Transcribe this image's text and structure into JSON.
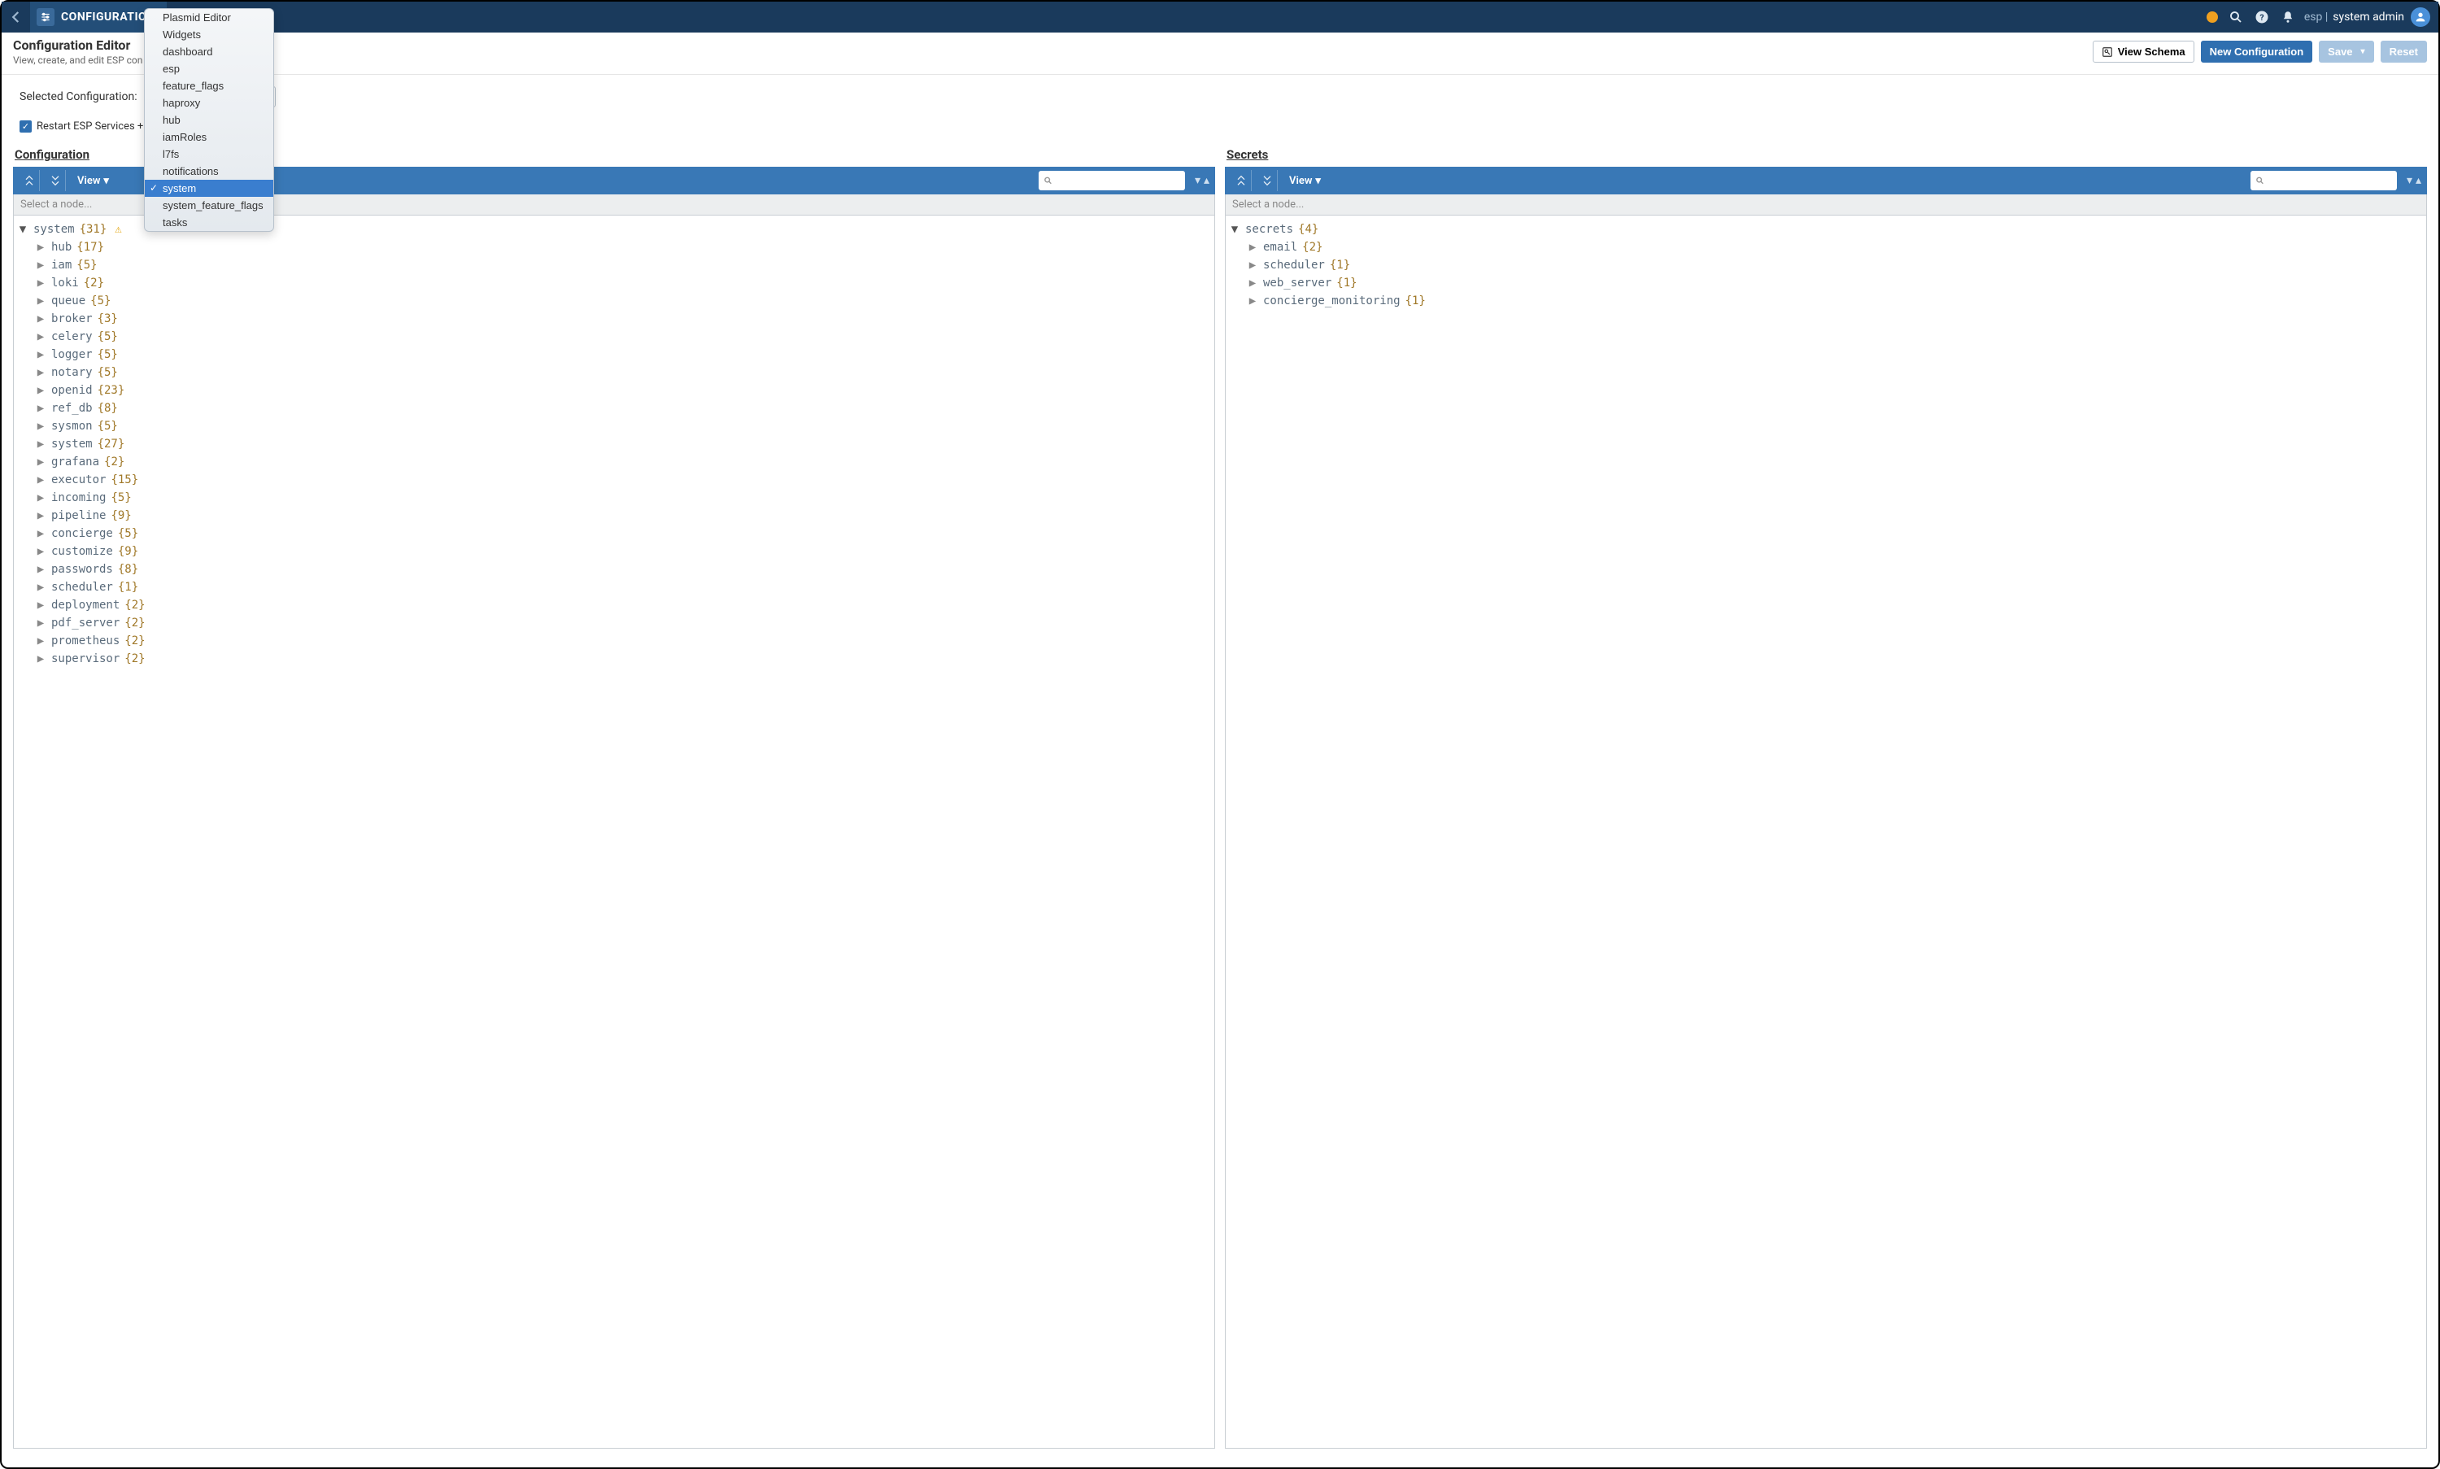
{
  "topnav": {
    "title": "CONFIGURATION",
    "env": "esp",
    "user": "system admin"
  },
  "page": {
    "title": "Configuration Editor",
    "subtitle": "View, create, and edit ESP con"
  },
  "actions": {
    "view_schema": "View Schema",
    "new_config": "New Configuration",
    "save": "Save",
    "reset": "Reset"
  },
  "config_select": {
    "label": "Selected Configuration:",
    "value": "",
    "restart_label": "Restart ESP Services +"
  },
  "dropdown_items": [
    {
      "label": "Plasmid Editor",
      "selected": false
    },
    {
      "label": "Widgets",
      "selected": false
    },
    {
      "label": "dashboard",
      "selected": false
    },
    {
      "label": "esp",
      "selected": false
    },
    {
      "label": "feature_flags",
      "selected": false
    },
    {
      "label": "haproxy",
      "selected": false
    },
    {
      "label": "hub",
      "selected": false
    },
    {
      "label": "iamRoles",
      "selected": false
    },
    {
      "label": "l7fs",
      "selected": false
    },
    {
      "label": "notifications",
      "selected": false
    },
    {
      "label": "system",
      "selected": true
    },
    {
      "label": "system_feature_flags",
      "selected": false
    },
    {
      "label": "tasks",
      "selected": false
    }
  ],
  "panels": {
    "left": {
      "heading": "Configuration",
      "view_label": "View",
      "node_placeholder": "Select a node...",
      "root": {
        "key": "system",
        "count": 31,
        "warn": true
      },
      "children": [
        {
          "key": "hub",
          "count": 17
        },
        {
          "key": "iam",
          "count": 5
        },
        {
          "key": "loki",
          "count": 2
        },
        {
          "key": "queue",
          "count": 5
        },
        {
          "key": "broker",
          "count": 3
        },
        {
          "key": "celery",
          "count": 5
        },
        {
          "key": "logger",
          "count": 5
        },
        {
          "key": "notary",
          "count": 5
        },
        {
          "key": "openid",
          "count": 23
        },
        {
          "key": "ref_db",
          "count": 8
        },
        {
          "key": "sysmon",
          "count": 5
        },
        {
          "key": "system",
          "count": 27
        },
        {
          "key": "grafana",
          "count": 2
        },
        {
          "key": "executor",
          "count": 15
        },
        {
          "key": "incoming",
          "count": 5
        },
        {
          "key": "pipeline",
          "count": 9
        },
        {
          "key": "concierge",
          "count": 5
        },
        {
          "key": "customize",
          "count": 9
        },
        {
          "key": "passwords",
          "count": 8
        },
        {
          "key": "scheduler",
          "count": 1
        },
        {
          "key": "deployment",
          "count": 2
        },
        {
          "key": "pdf_server",
          "count": 2
        },
        {
          "key": "prometheus",
          "count": 2
        },
        {
          "key": "supervisor",
          "count": 2
        }
      ]
    },
    "right": {
      "heading": "Secrets",
      "view_label": "View",
      "node_placeholder": "Select a node...",
      "root": {
        "key": "secrets",
        "count": 4
      },
      "children": [
        {
          "key": "email",
          "count": 2
        },
        {
          "key": "scheduler",
          "count": 1
        },
        {
          "key": "web_server",
          "count": 1
        },
        {
          "key": "concierge_monitoring",
          "count": 1
        }
      ]
    }
  }
}
